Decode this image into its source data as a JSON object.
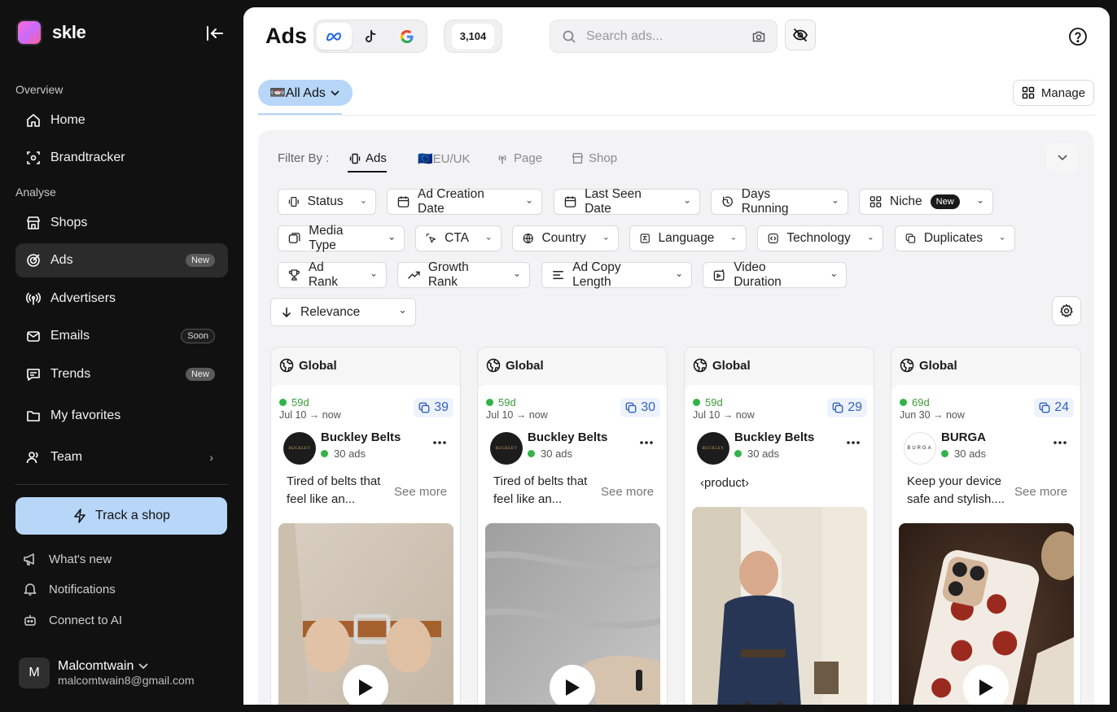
{
  "brand": {
    "name": "skle"
  },
  "sidebar": {
    "sections": {
      "overview": "Overview",
      "analyse": "Analyse"
    },
    "items": [
      {
        "label": "Home"
      },
      {
        "label": "Brandtracker"
      },
      {
        "label": "Shops"
      },
      {
        "label": "Ads",
        "badge": "New"
      },
      {
        "label": "Advertisers"
      },
      {
        "label": "Emails",
        "badge": "Soon"
      },
      {
        "label": "Trends",
        "badge": "New"
      },
      {
        "label": "My favorites"
      },
      {
        "label": "Team"
      }
    ],
    "track_button": "Track a shop",
    "footer": [
      {
        "label": "What's new"
      },
      {
        "label": "Notifications"
      },
      {
        "label": "Connect to AI"
      }
    ],
    "user": {
      "initial": "M",
      "name": "Malcomtwain",
      "email": "malcomtwain8@gmail.com"
    }
  },
  "header": {
    "title": "Ads",
    "ad_count": "3,104",
    "search_placeholder": "Search ads..."
  },
  "tabs": {
    "all_ads": "📼All Ads",
    "manage": "Manage"
  },
  "filters": {
    "filter_by_label": "Filter By :",
    "filter_tabs": [
      "Ads",
      "🇪🇺EU/UK",
      "Page",
      "Shop"
    ],
    "chips": {
      "status": "Status",
      "ad_creation_date": "Ad Creation Date",
      "last_seen_date": "Last Seen Date",
      "days_running": "Days Running",
      "niche": "Niche",
      "niche_badge": "New",
      "media_type": "Media Type",
      "cta": "CTA",
      "country": "Country",
      "language": "Language",
      "technology": "Technology",
      "duplicates": "Duplicates",
      "ad_rank": "Ad Rank",
      "growth_rank": "Growth Rank",
      "ad_copy_length": "Ad Copy Length",
      "video_duration": "Video Duration",
      "sort": "Relevance"
    }
  },
  "cards": [
    {
      "region": "Global",
      "days": "59d",
      "range": "Jul 10 → now",
      "duplicates": "39",
      "advertiser": "Buckley Belts",
      "logo_text": "BUCKLEY",
      "ads": "30 ads",
      "copy": "Tired of belts that feel like an...",
      "see_more": "See more",
      "media": "belt-buckle-video"
    },
    {
      "region": "Global",
      "days": "59d",
      "range": "Jul 10 → now",
      "duplicates": "30",
      "advertiser": "Buckley Belts",
      "logo_text": "BUCKLEY",
      "ads": "30 ads",
      "copy": "Tired of belts that feel like an...",
      "see_more": "See more",
      "media": "belt-hands-video"
    },
    {
      "region": "Global",
      "days": "59d",
      "range": "Jul 10 → now",
      "duplicates": "29",
      "advertiser": "Buckley Belts",
      "logo_text": "BUCKLEY",
      "ads": "30 ads",
      "copy": "‹product›",
      "see_more": "",
      "media": "man-belt-photo"
    },
    {
      "region": "Global",
      "days": "69d",
      "range": "Jun 30 → now",
      "duplicates": "24",
      "advertiser": "BURGA",
      "logo_text": "BURGA",
      "ads": "30 ads",
      "copy": "Keep your device safe and stylish....",
      "see_more": "See more",
      "media": "phone-case-video"
    }
  ],
  "colors": {
    "accent": "#b7d6f8",
    "active_green": "#32b34a",
    "sidebar_bg": "#111111"
  }
}
